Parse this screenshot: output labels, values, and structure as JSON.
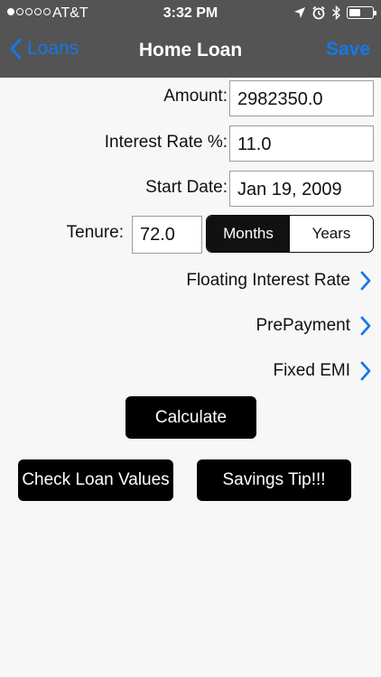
{
  "status_bar": {
    "carrier": "AT&T",
    "time": "3:32 PM",
    "signal_dots": [
      true,
      false,
      false,
      false,
      false
    ]
  },
  "nav": {
    "back_label": "Loans",
    "title": "Home Loan",
    "save_label": "Save"
  },
  "form": {
    "amount": {
      "label": "Amount:",
      "value": "2982350.0"
    },
    "interest_rate": {
      "label": "Interest Rate %:",
      "value": "11.0"
    },
    "start_date": {
      "label": "Start Date:",
      "value": "Jan 19, 2009"
    },
    "tenure": {
      "label": "Tenure:",
      "value": "72.0",
      "options": [
        "Months",
        "Years"
      ],
      "selected": "Months"
    }
  },
  "links": {
    "floating_rate": "Floating Interest Rate",
    "prepayment": "PrePayment",
    "fixed_emi": "Fixed EMI"
  },
  "buttons": {
    "calculate": "Calculate",
    "check_values": "Check Loan Values",
    "savings_tip": "Savings Tip!!!"
  },
  "colors": {
    "header_bg": "#545454",
    "accent": "#1478e8",
    "button_bg": "#000000",
    "page_bg": "#f7f7f7"
  }
}
